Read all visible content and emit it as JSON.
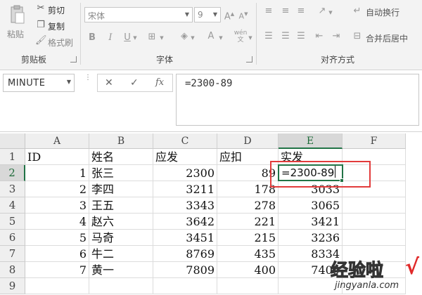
{
  "ribbon": {
    "clipboard": {
      "paste": "粘贴",
      "cut": "剪切",
      "copy": "复制",
      "format_painter": "格式刷",
      "label": "剪贴板"
    },
    "font": {
      "name": "宋体",
      "size": "9",
      "bold": "B",
      "italic": "I",
      "underline": "U",
      "label": "字体"
    },
    "alignment": {
      "wrap": "自动换行",
      "merge": "合并后居中",
      "label": "对齐方式"
    }
  },
  "formula_bar": {
    "name_box": "MINUTE",
    "cancel": "✕",
    "enter": "✓",
    "fx": "fx",
    "formula": "=2300-89"
  },
  "sheet": {
    "columns": [
      "A",
      "B",
      "C",
      "D",
      "E",
      "F"
    ],
    "rows": [
      "1",
      "2",
      "3",
      "4",
      "5",
      "6",
      "7",
      "8",
      "9"
    ],
    "header": [
      "ID",
      "姓名",
      "应发",
      "应扣",
      "实发"
    ],
    "data": [
      [
        "1",
        "张三",
        "2300",
        "89",
        "=2300-89"
      ],
      [
        "2",
        "李四",
        "3211",
        "178",
        "3033"
      ],
      [
        "3",
        "王五",
        "3343",
        "278",
        "3065"
      ],
      [
        "4",
        "赵六",
        "3642",
        "221",
        "3421"
      ],
      [
        "5",
        "马奇",
        "3451",
        "215",
        "3236"
      ],
      [
        "6",
        "牛二",
        "8769",
        "435",
        "8334"
      ],
      [
        "7",
        "黄一",
        "7809",
        "400",
        "7409"
      ]
    ]
  },
  "watermark": {
    "title": "经验啦",
    "check": "√",
    "url": "jingyanla.com"
  }
}
